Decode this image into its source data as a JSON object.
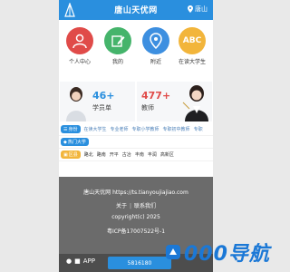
{
  "header": {
    "title": "唐山天优网",
    "location": "唐山"
  },
  "quick_icons": [
    {
      "label": "个人中心",
      "color": "#e04b49",
      "icon": "user-icon"
    },
    {
      "label": "我的",
      "color": "#45b46b",
      "icon": "edit-icon"
    },
    {
      "label": "附近",
      "color": "#3d8fe0",
      "icon": "location-pin-icon"
    },
    {
      "label": "在读大学生",
      "color": "#f2b53b",
      "icon": "abc-icon",
      "glyph": "ABC"
    }
  ],
  "banners": [
    {
      "number": "46+",
      "label": "学员单",
      "color": "#2a8fde"
    },
    {
      "number": "477+",
      "label": "教师",
      "color": "#e04b49"
    }
  ],
  "rows": [
    {
      "badge": "身份",
      "items": [
        "在读大学生",
        "专业老师",
        "专职小学教师",
        "专职初中教师",
        "专职"
      ]
    },
    {
      "badge": "热门大学",
      "items": []
    },
    {
      "badge": "区县",
      "items": [
        "路北",
        "路南",
        "开平",
        "古冶",
        "丰南",
        "丰润",
        "高新区"
      ]
    }
  ],
  "footer": {
    "site": "唐山天优网  https://ts.tianyoujiajiao.com",
    "about": "关于",
    "contact": "联系我们",
    "copyright": "copyright(c) 2025",
    "icp": "粤ICP备17007522号-1",
    "app": "APP",
    "phone": "5816180"
  },
  "watermark": {
    "text": "000导航"
  }
}
